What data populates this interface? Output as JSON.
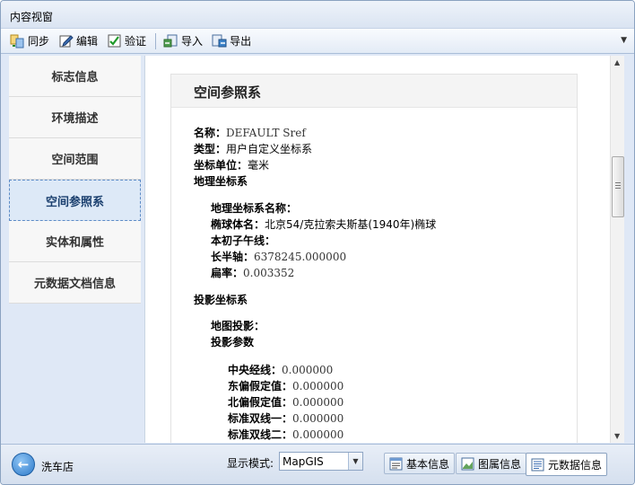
{
  "window": {
    "title": "内容视窗"
  },
  "toolbar": {
    "items": [
      {
        "label": "同步",
        "icon": "sync-icon"
      },
      {
        "label": "编辑",
        "icon": "edit-icon"
      },
      {
        "label": "验证",
        "icon": "validate-icon"
      },
      {
        "label": "导入",
        "icon": "import-icon"
      },
      {
        "label": "导出",
        "icon": "export-icon"
      }
    ]
  },
  "sidebar": {
    "items": [
      {
        "label": "标志信息"
      },
      {
        "label": "环境描述"
      },
      {
        "label": "空间范围"
      },
      {
        "label": "空间参照系",
        "active": true
      },
      {
        "label": "实体和属性"
      },
      {
        "label": "元数据文档信息"
      }
    ]
  },
  "content": {
    "header": "空间参照系",
    "name_label": "名称：",
    "name_value": "DEFAULT Sref",
    "type_label": "类型：",
    "type_value": "用户自定义坐标系",
    "unit_label": "坐标单位：",
    "unit_value": "毫米",
    "geo_title": "地理坐标系",
    "geo_name_label": "地理坐标系名称：",
    "ellipsoid_label": "椭球体名：",
    "ellipsoid_value": "北京54/克拉索夫斯基(1940年)椭球",
    "meridian_label": "本初子午线：",
    "semi_major_label": "长半轴：",
    "semi_major_value": "6378245.000000",
    "flattening_label": "扁率：",
    "flattening_value": "0.003352",
    "proj_title": "投影坐标系",
    "map_proj_label": "地图投影：",
    "proj_params_label": "投影参数",
    "central_meridian_label": "中央经线：",
    "central_meridian_value": "0.000000",
    "false_easting_label": "东偏假定值：",
    "false_easting_value": "0.000000",
    "false_northing_label": "北偏假定值：",
    "false_northing_value": "0.000000",
    "std_parallel1_label": "标准双线一：",
    "std_parallel1_value": "0.000000",
    "std_parallel2_label": "标准双线二：",
    "std_parallel2_value": "0.000000"
  },
  "statusbar": {
    "location": "洗车店",
    "mode_label": "显示模式:",
    "mode_value": "MapGIS",
    "tabs": [
      {
        "label": "基本信息",
        "icon": "basic-info-icon"
      },
      {
        "label": "图属信息",
        "icon": "map-attribute-icon"
      },
      {
        "label": "元数据信息",
        "icon": "metadata-icon",
        "active": true
      }
    ]
  },
  "colors": {
    "accent": "#5d8bc6",
    "panel": "#dfe8f6",
    "active_item": "#dde9f7"
  }
}
